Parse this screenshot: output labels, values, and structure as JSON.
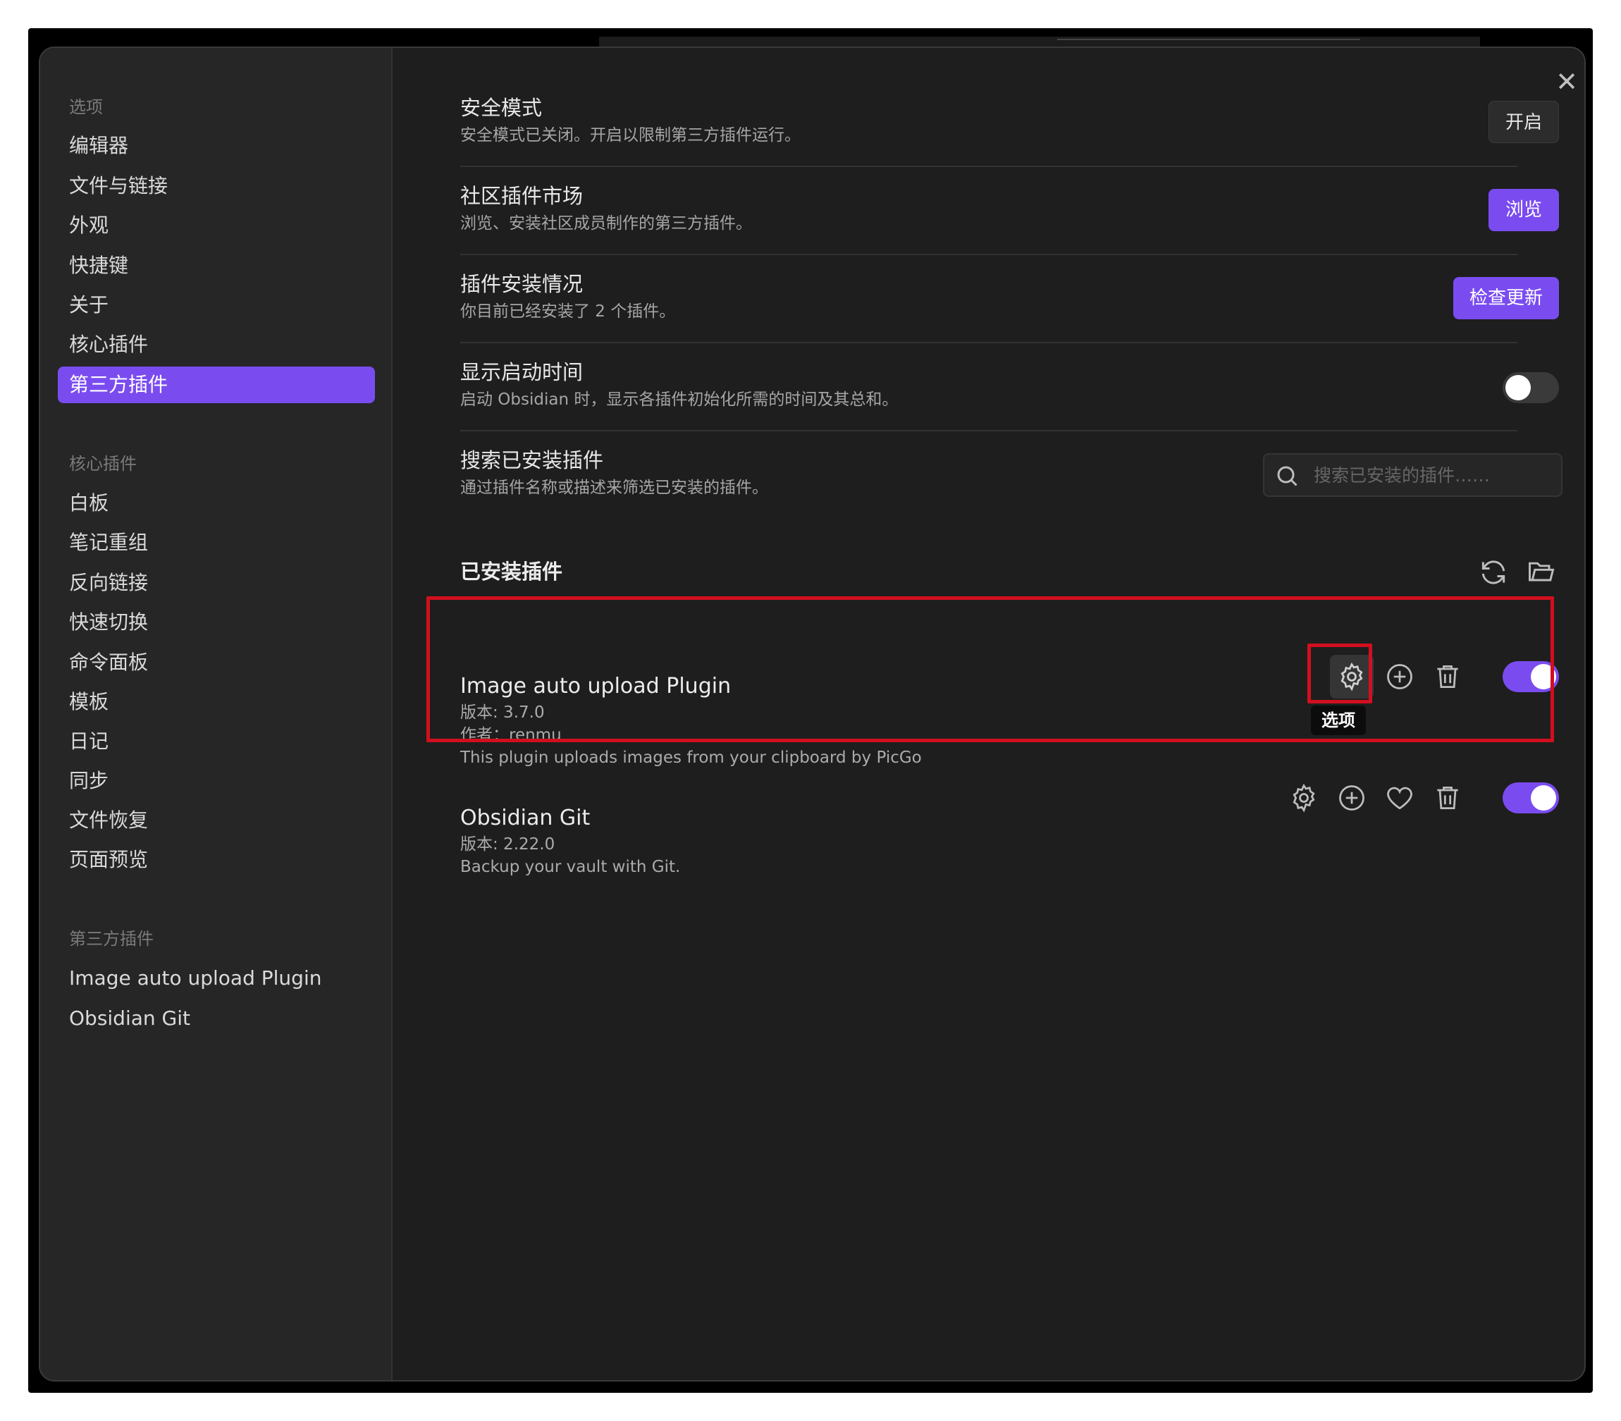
{
  "sidebar": {
    "options_title": "选项",
    "options": [
      "编辑器",
      "文件与链接",
      "外观",
      "快捷键",
      "关于",
      "核心插件",
      "第三方插件"
    ],
    "core_title": "核心插件",
    "core_plugins": [
      "白板",
      "笔记重组",
      "反向链接",
      "快速切换",
      "命令面板",
      "模板",
      "日记",
      "同步",
      "文件恢复",
      "页面预览"
    ],
    "community_title": "第三方插件",
    "community_plugins": [
      "Image auto upload Plugin",
      "Obsidian Git"
    ]
  },
  "close_label": "✕",
  "settings": {
    "safe_mode": {
      "title": "安全模式",
      "desc": "安全模式已关闭。开启以限制第三方插件运行。",
      "button": "开启"
    },
    "market": {
      "title": "社区插件市场",
      "desc": "浏览、安装社区成员制作的第三方插件。",
      "button": "浏览"
    },
    "installed": {
      "title": "插件安装情况",
      "desc": "你目前已经安装了 2 个插件。",
      "button": "检查更新"
    },
    "startup_time": {
      "title": "显示启动时间",
      "desc": "启动 Obsidian 时，显示各插件初始化所需的时间及其总和。",
      "enabled": false
    },
    "search": {
      "title": "搜索已安装插件",
      "desc": "通过插件名称或描述来筛选已安装的插件。",
      "placeholder": "搜索已安装的插件……"
    }
  },
  "installed_section_title": "已安装插件",
  "plugins": [
    {
      "name": "Image auto upload Plugin",
      "version": "版本: 3.7.0",
      "author": "作者：renmu",
      "desc": "This plugin uploads images from your clipboard by PicGo",
      "enabled": true
    },
    {
      "name": "Obsidian Git",
      "version": "版本: 2.22.0",
      "desc": "Backup your vault with Git.",
      "enabled": true
    }
  ],
  "tooltip": "选项",
  "colors": {
    "accent": "#7a4cf0",
    "highlight": "#d20f1e",
    "background": "#1e1e1e"
  }
}
